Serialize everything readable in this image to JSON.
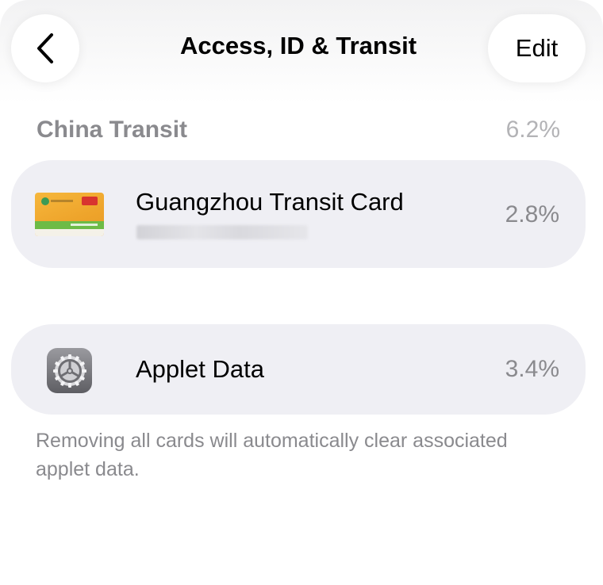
{
  "nav": {
    "title": "Access, ID & Transit",
    "edit_label": "Edit",
    "back_icon": "chevron-left-icon"
  },
  "section": {
    "title": "China Transit",
    "percent": "6.2%"
  },
  "rows": [
    {
      "label": "Guangzhou Transit Card",
      "percent": "2.8%",
      "icon": "transit-card-icon"
    },
    {
      "label": "Applet Data",
      "percent": "3.4%",
      "icon": "settings-gear-icon"
    }
  ],
  "footnote": "Removing all cards will automatically clear associated applet data.",
  "colors": {
    "row_background": "#efeff4",
    "secondary_text": "#8a8a8e"
  }
}
